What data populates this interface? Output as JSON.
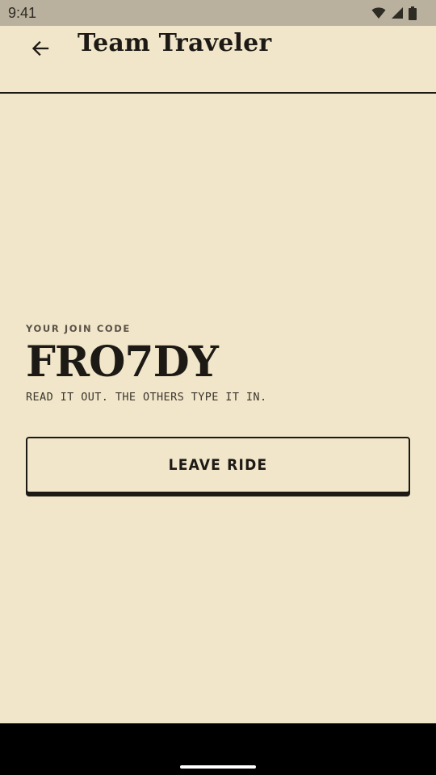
{
  "status_bar": {
    "time": "9:41",
    "icons": [
      "wifi-icon",
      "cell-signal-icon",
      "battery-icon"
    ]
  },
  "app_bar": {
    "back_icon": "arrow-left-icon",
    "title": "Team Traveler"
  },
  "join": {
    "label": "YOUR JOIN CODE",
    "code": "FRO7DY",
    "hint": "READ IT OUT. THE OTHERS TYPE IT IN."
  },
  "actions": {
    "leave_label": "LEAVE RIDE"
  },
  "colors": {
    "background": "#f1e6c9",
    "ink": "#1d1a16",
    "status_bar": "#b9b09d",
    "nav_bar": "#000000"
  }
}
